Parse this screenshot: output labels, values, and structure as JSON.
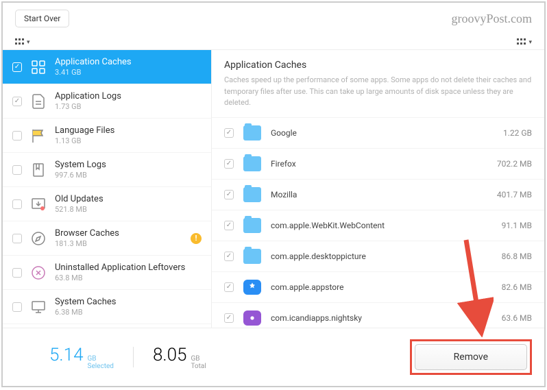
{
  "header": {
    "start_over": "Start Over",
    "watermark": "groovyPost.com"
  },
  "sidebar": {
    "items": [
      {
        "name": "Application Caches",
        "size": "3.41 GB",
        "checked": true,
        "selected": true,
        "icon": "grid"
      },
      {
        "name": "Application Logs",
        "size": "1.73 GB",
        "checked": true,
        "selected": false,
        "icon": "log"
      },
      {
        "name": "Language Files",
        "size": "1.13 GB",
        "checked": false,
        "selected": false,
        "icon": "flag"
      },
      {
        "name": "System Logs",
        "size": "997.6 MB",
        "checked": false,
        "selected": false,
        "icon": "bookmark"
      },
      {
        "name": "Old Updates",
        "size": "521.8 MB",
        "checked": false,
        "selected": false,
        "icon": "download"
      },
      {
        "name": "Browser Caches",
        "size": "181.3 MB",
        "checked": false,
        "selected": false,
        "icon": "compass",
        "warning": true
      },
      {
        "name": "Uninstalled Application Leftovers",
        "size": "63.8 MB",
        "checked": false,
        "selected": false,
        "icon": "x"
      },
      {
        "name": "System Caches",
        "size": "6.38 MB",
        "checked": false,
        "selected": false,
        "icon": "monitor"
      }
    ]
  },
  "detail": {
    "title": "Application Caches",
    "description": "Caches speed up the performance of some apps. Some apps do not delete their caches and temporary files after use. This can take up large amounts of disk space unless they are deleted.",
    "items": [
      {
        "name": "Google",
        "size": "1.22 GB",
        "type": "folder"
      },
      {
        "name": "Firefox",
        "size": "702.2 MB",
        "type": "folder"
      },
      {
        "name": "Mozilla",
        "size": "401.7 MB",
        "type": "folder"
      },
      {
        "name": "com.apple.WebKit.WebContent",
        "size": "91.1 MB",
        "type": "folder"
      },
      {
        "name": "com.apple.desktoppicture",
        "size": "86.8 MB",
        "type": "folder"
      },
      {
        "name": "com.apple.appstore",
        "size": "82.6 MB",
        "type": "app-blue"
      },
      {
        "name": "com.icandiapps.nightsky",
        "size": "63.6 MB",
        "type": "app-purple"
      }
    ]
  },
  "footer": {
    "selected_num": "5.14",
    "selected_unit": "GB",
    "selected_label": "Selected",
    "total_num": "8.05",
    "total_unit": "GB",
    "total_label": "Total",
    "remove": "Remove"
  }
}
